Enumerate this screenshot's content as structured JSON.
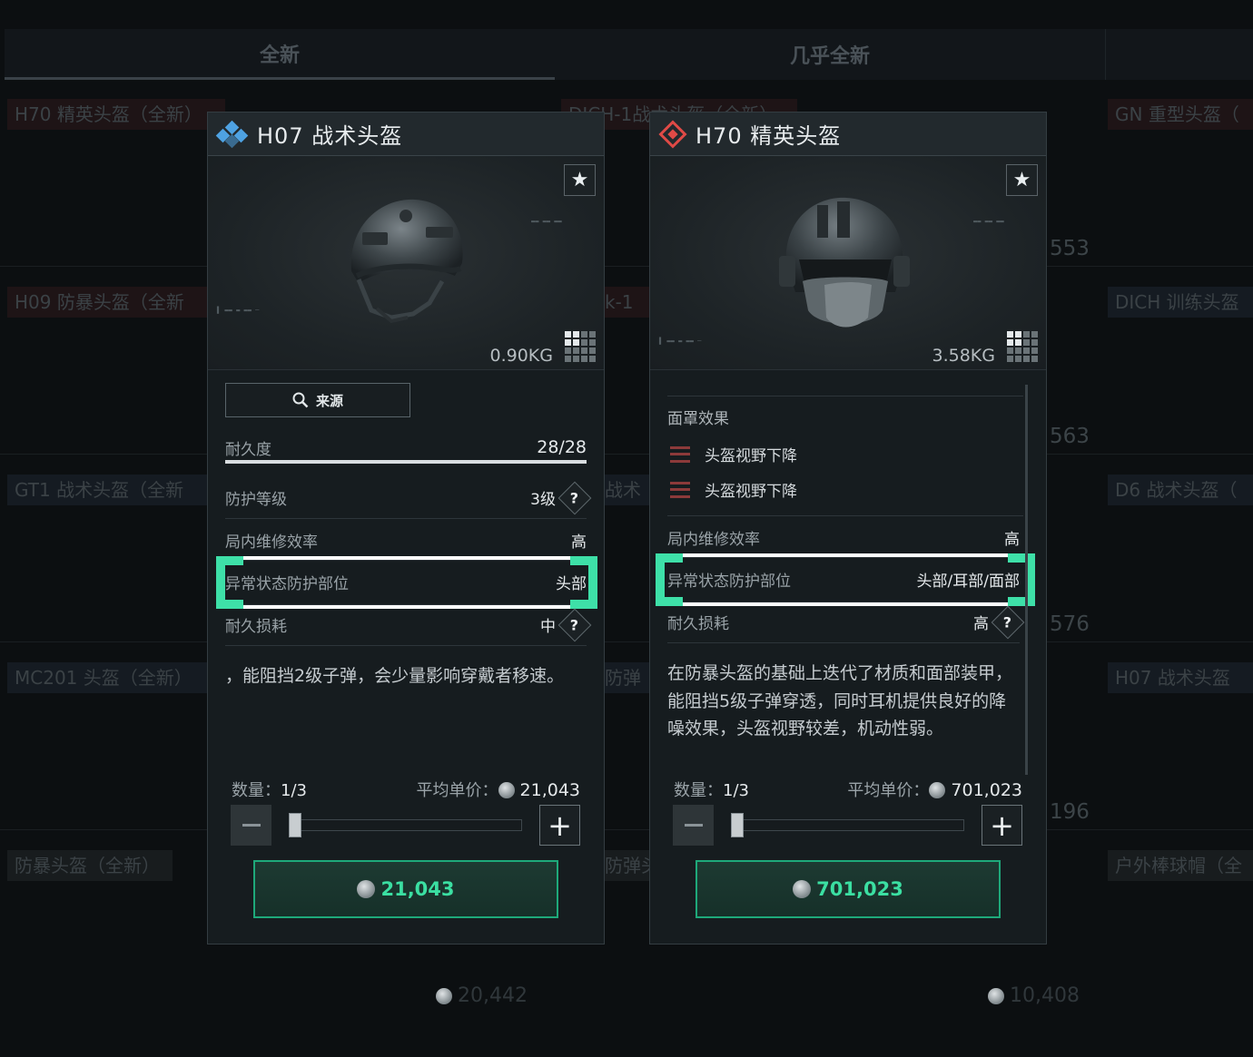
{
  "tabs": {
    "brand_new": "全新",
    "almost_new": "几乎全新"
  },
  "background": {
    "col1": [
      "H70 精英头盔（全新）",
      "H09 防暴头盔（全新",
      "GT1 战术头盔（全新",
      "MC201 头盔（全新）",
      "防暴头盔（全新）"
    ],
    "col2": [
      "DICH-1战术头盔（全新）",
      "k-1",
      "战术",
      "防弹",
      "防弹头"
    ],
    "col3": [
      "GN 重型头盔（",
      "DICH 训练头盔",
      "D6 战术头盔（",
      "H07 战术头盔",
      "户外棒球帽（全"
    ],
    "prices": [
      "553",
      "563",
      "576",
      "196"
    ],
    "bottom_prices": [
      "20,442",
      "10,408"
    ]
  },
  "left_card": {
    "title": "H07 战术头盔",
    "rarity_color": "#4ea2e2",
    "weight": "0.90KG",
    "source_label": "来源",
    "durability_label": "耐久度",
    "durability_value": "28/28",
    "durability_fraction": 1.0,
    "protection_label": "防护等级",
    "protection_value": "3级",
    "repair_label": "局内维修效率",
    "repair_value": "高",
    "abnormal_label": "异常状态防护部位",
    "abnormal_value": "头部",
    "wear_label": "耐久损耗",
    "wear_value": "中",
    "help": "?",
    "description": "，能阻挡2级子弹，会少量影响穿戴者移速。",
    "qty_label": "数量：",
    "qty_value": "1/3",
    "avg_price_label": "平均单价：",
    "avg_price": "21,043",
    "buy_price": "21,043"
  },
  "right_card": {
    "title": "H70 精英头盔",
    "rarity_color": "#e04a46",
    "weight": "3.58KG",
    "mask_effect_label": "面罩效果",
    "effects": [
      "头盔视野下降",
      "头盔视野下降"
    ],
    "repair_label": "局内维修效率",
    "repair_value": "高",
    "abnormal_label": "异常状态防护部位",
    "abnormal_value": "头部/耳部/面部",
    "wear_label": "耐久损耗",
    "wear_value": "高",
    "help": "?",
    "description": "在防暴头盔的基础上迭代了材质和面部装甲，能阻挡5级子弹穿透，同时耳机提供良好的降噪效果，头盔视野较差，机动性弱。",
    "qty_label": "数量：",
    "qty_value": "1/3",
    "avg_price_label": "平均单价：",
    "avg_price": "701,023",
    "buy_price": "701,023"
  },
  "icons": {
    "star": "★",
    "plus": "+",
    "search": "search-icon"
  },
  "colors": {
    "accent_green": "#3ee0a8",
    "price_green": "#3bdfa2"
  }
}
